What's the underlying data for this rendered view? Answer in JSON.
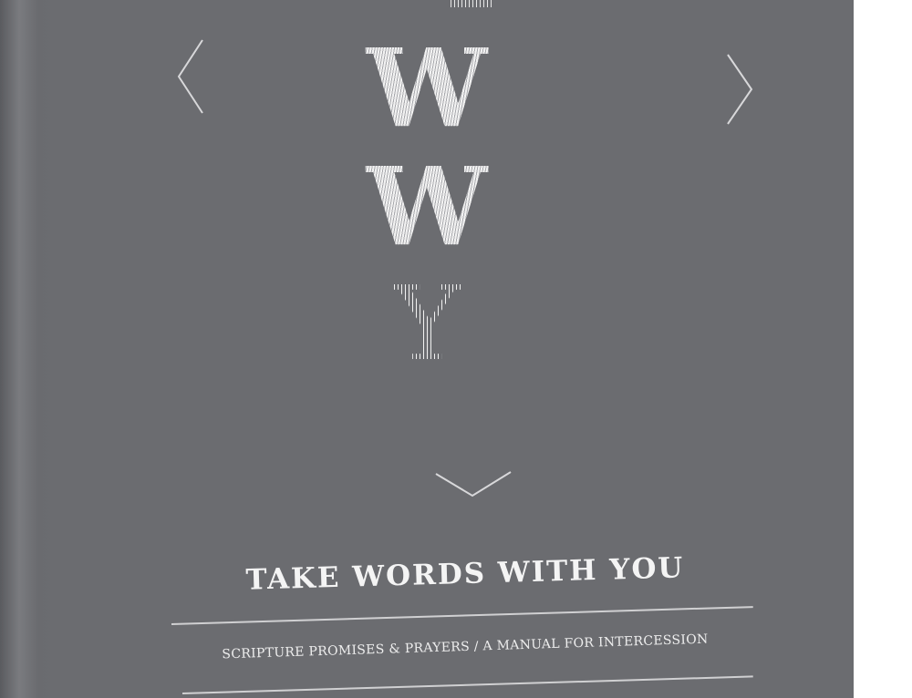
{
  "cover": {
    "background_color": "#6b6c70",
    "monogram": {
      "letter_1": "W",
      "letter_2": "W",
      "letter_3": "Y"
    },
    "icons": {
      "left": "chevron-left-icon",
      "right": "chevron-right-icon",
      "down": "chevron-down-icon"
    },
    "title": "TAKE WORDS WITH YOU",
    "subtitle": "SCRIPTURE PROMISES & PRAYERS / A MANUAL FOR INTERCESSION"
  }
}
